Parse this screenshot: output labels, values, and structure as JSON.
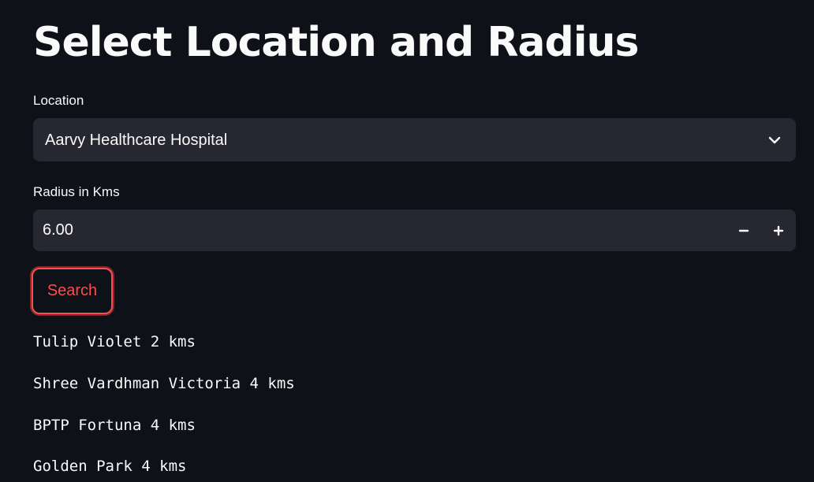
{
  "page": {
    "title": "Select Location and Radius"
  },
  "location": {
    "label": "Location",
    "selected": "Aarvy Healthcare Hospital",
    "icon": "chevron-down-icon"
  },
  "radius": {
    "label": "Radius in Kms",
    "value": "6.00",
    "decrement_icon": "minus-icon",
    "increment_icon": "plus-icon"
  },
  "search": {
    "label": "Search"
  },
  "results": [
    "Tulip Violet 2 kms",
    "Shree Vardhman Victoria 4 kms",
    "BPTP Fortuna 4 kms",
    "Golden Park 4 kms"
  ],
  "colors": {
    "background": "#0e1117",
    "input_background": "#262730",
    "accent": "#ff4b4b",
    "text": "#fafafa"
  }
}
